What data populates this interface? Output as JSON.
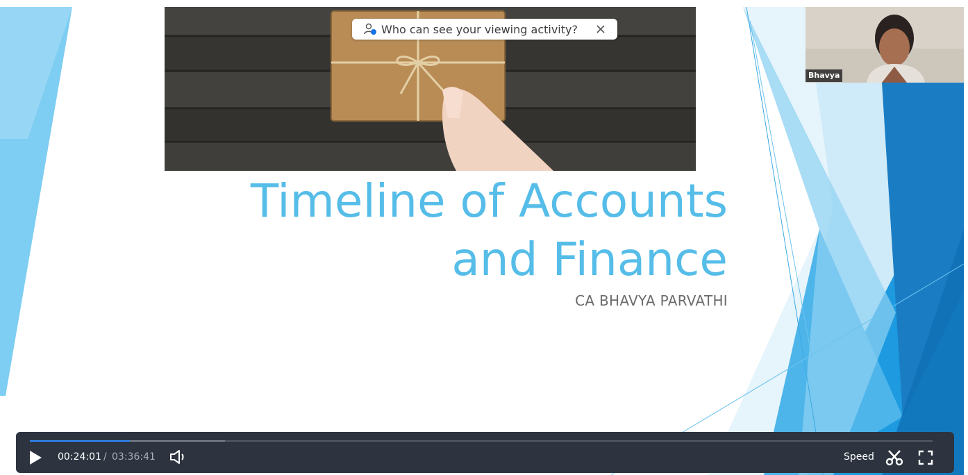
{
  "slide": {
    "title_line1": "Timeline of Accounts",
    "title_line2": "and Finance",
    "subtitle": "CA  BHAVYA PARVATHI"
  },
  "privacy_banner": {
    "text": "Who can see your viewing activity?",
    "icon": "user-privacy-icon",
    "close_icon": "close-icon"
  },
  "participant": {
    "name": "Bhavya"
  },
  "player": {
    "current_time": "00:24:01",
    "separator": "/",
    "total_time": "03:36:41",
    "progress_fraction": 0.111,
    "buffered_fraction": 0.216,
    "speed_label": "Speed",
    "icons": [
      "play-icon",
      "volume-icon",
      "scissors-icon",
      "fullscreen-icon"
    ]
  },
  "colors": {
    "title": "#56bde8",
    "accent_blue": "#2d8cff",
    "player_bg": "#2d3440",
    "slide_deco": "#1e9be0"
  }
}
